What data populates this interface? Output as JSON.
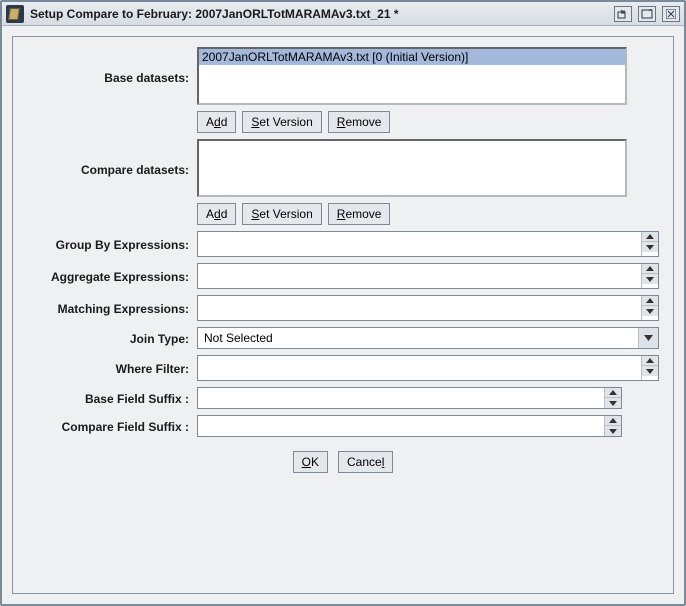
{
  "window": {
    "title": "Setup Compare to February: 2007JanORLTotMARAMAv3.txt_21 *"
  },
  "labels": {
    "base_datasets": "Base datasets:",
    "compare_datasets": "Compare datasets:",
    "group_by": "Group By Expressions:",
    "aggregate": "Aggregate Expressions:",
    "matching": "Matching Expressions:",
    "join_type": "Join Type:",
    "where_filter": "Where Filter:",
    "base_suffix": "Base Field Suffix :",
    "compare_suffix": "Compare Field Suffix :"
  },
  "base_datasets": {
    "items": [
      "2007JanORLTotMARAMAv3.txt [0 (Initial Version)]"
    ]
  },
  "compare_datasets": {
    "items": []
  },
  "buttons": {
    "add_pre": "A",
    "add_mn": "d",
    "add_post": "d",
    "setver_pre": "",
    "setver_mn": "S",
    "setver_post": "et Version",
    "remove_pre": "",
    "remove_mn": "R",
    "remove_post": "emove",
    "ok_pre": "",
    "ok_mn": "O",
    "ok_post": "K",
    "cancel_pre": "Cance",
    "cancel_mn": "l",
    "cancel_post": ""
  },
  "fields": {
    "group_by": "",
    "aggregate": "",
    "matching": "",
    "join_type": "Not Selected",
    "where_filter": "",
    "base_suffix": "",
    "compare_suffix": ""
  }
}
